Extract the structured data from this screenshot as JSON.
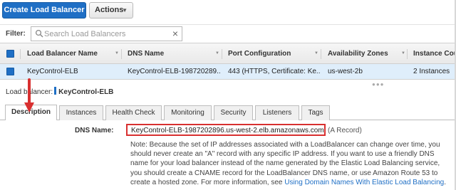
{
  "toolbar": {
    "create_label": "Create Load Balancer",
    "actions_label": "Actions"
  },
  "filter": {
    "label": "Filter:",
    "placeholder": "Search Load Balancers"
  },
  "table": {
    "columns": [
      "Load Balancer Name",
      "DNS Name",
      "Port Configuration",
      "Availability Zones",
      "Instance Cou"
    ],
    "rows": [
      {
        "name": "KeyControl-ELB",
        "dns": "KeyControl-ELB-198720289...",
        "port": "443 (HTTPS, Certificate: Ke...",
        "zones": "us-west-2b",
        "instances": "2 Instances"
      }
    ]
  },
  "detail": {
    "lb_prefix": "Load balancer:",
    "lb_name": "KeyControl-ELB",
    "tabs": [
      "Description",
      "Instances",
      "Health Check",
      "Monitoring",
      "Security",
      "Listeners",
      "Tags"
    ],
    "active_tab": "Description",
    "dns_label": "DNS Name:",
    "dns_value": "KeyControl-ELB-1987202896.us-west-2.elb.amazonaws.com",
    "dns_suffix": "(A Record)",
    "note_text": "Note: Because the set of IP addresses associated with a LoadBalancer can change over time, you should never create an \"A\" record with any specific IP address. If you want to use a friendly DNS name for your load balancer instead of the name generated by the Elastic Load Balancing service, you should create a CNAME record for the LoadBalancer DNS name, or use Amazon Route 53 to create a hosted zone. For more information, see ",
    "note_link": "Using Domain Names With Elastic Load Balancing",
    "note_end": "."
  },
  "colors": {
    "primary": "#1f6fc5",
    "selected_row": "#dfeefb",
    "annotation_red": "#d83030"
  },
  "icons": {
    "search": "search-icon",
    "clear": "close-icon",
    "dropdown": "chevron-down-icon",
    "annotation": "arrow-down-icon"
  }
}
